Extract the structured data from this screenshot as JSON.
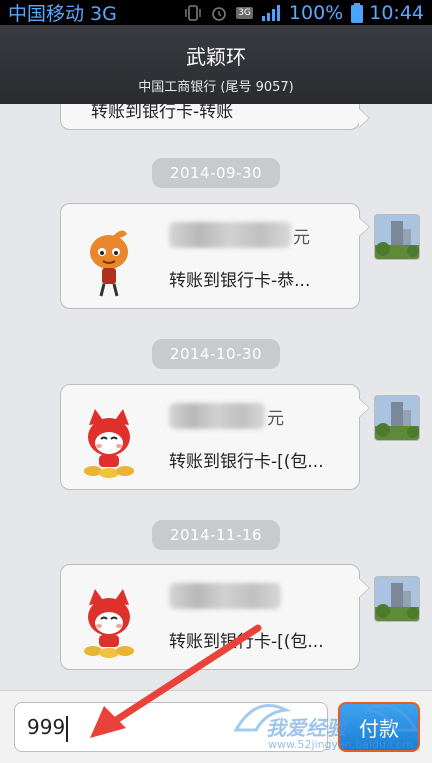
{
  "status_bar": {
    "carrier": "中国移动 3G",
    "network_badge": "3G",
    "battery": "100%",
    "time": "10:44"
  },
  "header": {
    "title": "武颖环",
    "subtitle": "中国工商银行 (尾号 9057)"
  },
  "messages": [
    {
      "description": "转账到银行卡-转账"
    },
    {
      "date": "2014-09-30",
      "amount_unit": "元",
      "description": "转账到银行卡-恭..."
    },
    {
      "date": "2014-10-30",
      "amount_unit": "元",
      "description": "转账到银行卡-[(包..."
    },
    {
      "date": "2014-11-16",
      "description": "转账到银行卡-[(包..."
    }
  ],
  "input": {
    "value": "999",
    "send_label": "付款"
  },
  "watermark": {
    "text": "我爱经验",
    "url": "www.52jingyan.baidu.com"
  },
  "colors": {
    "accent": "#1b7fd4",
    "header": "#2f3035",
    "annotation": "#e8423b"
  }
}
